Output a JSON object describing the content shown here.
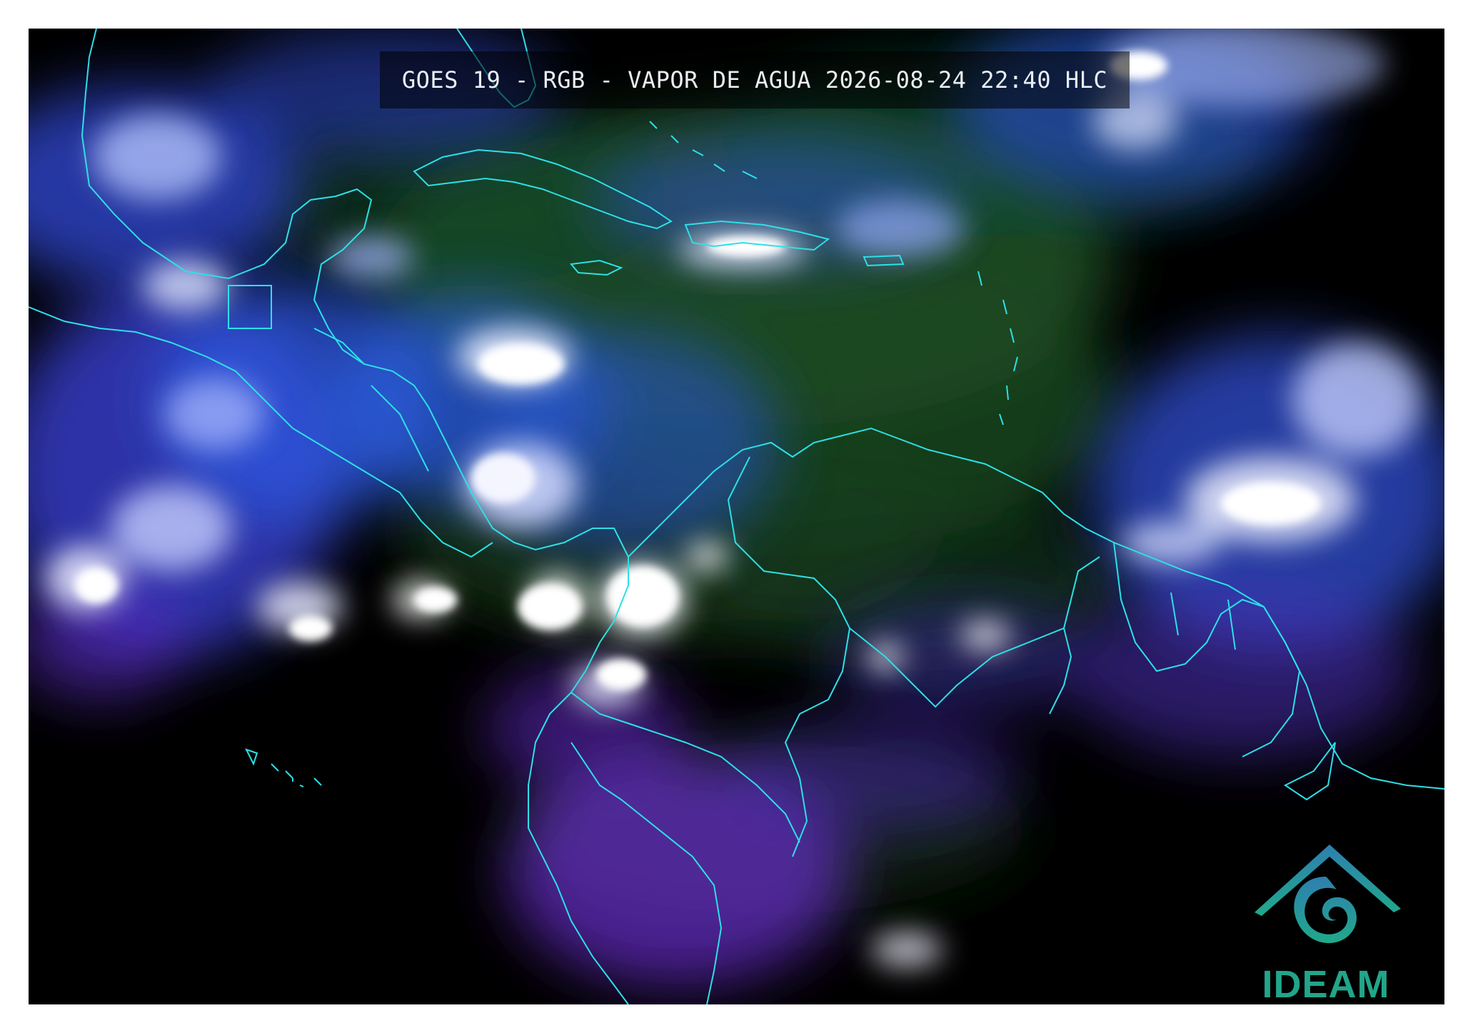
{
  "header": {
    "title": "GOES 19 - RGB - VAPOR DE AGUA 2026-08-24 22:40 HLC"
  },
  "logo": {
    "text": "IDEAM",
    "color": "#22a58a"
  },
  "colors": {
    "background": "#000000",
    "moist_green": "#1f5a2a",
    "cloud_white": "#e8ecff",
    "cloud_blue": "#3a63f0",
    "cloud_violet": "#6a2fd6",
    "coastline": "#2de0e6"
  }
}
